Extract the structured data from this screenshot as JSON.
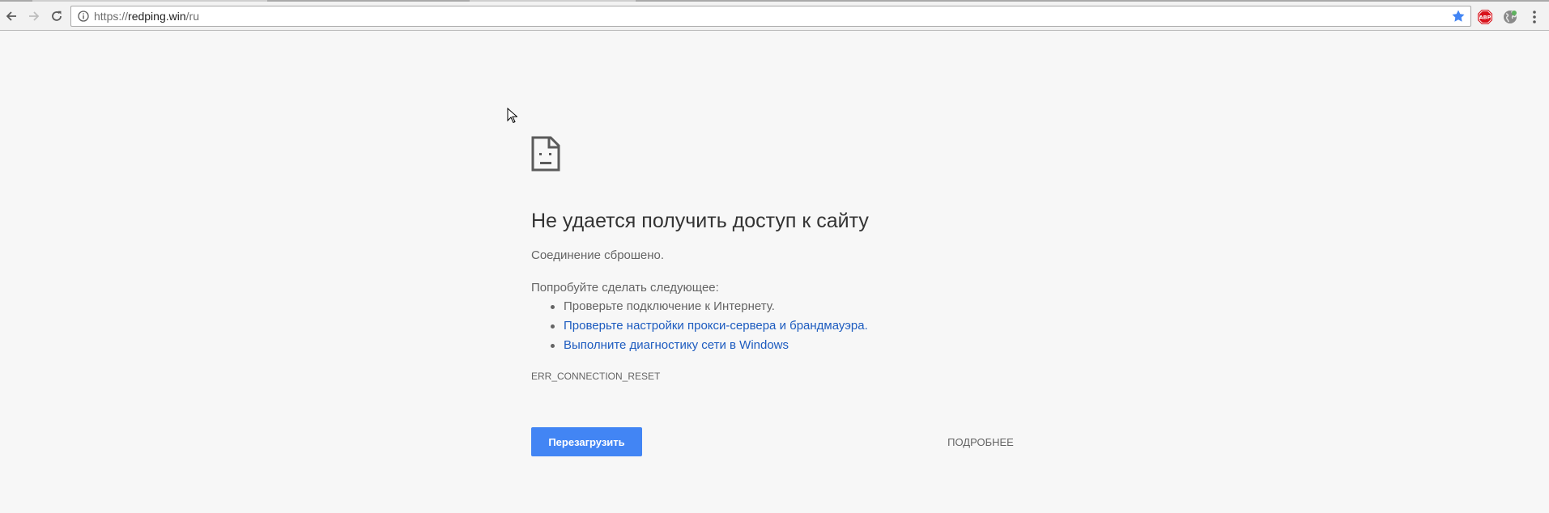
{
  "browser": {
    "url_scheme": "https://",
    "url_host": "redping.win",
    "url_path": "/ru",
    "colors": {
      "star": "#4285f4",
      "abp": "#d8121b"
    }
  },
  "error_page": {
    "heading": "Не удается получить доступ к сайту",
    "message": "Соединение сброшено.",
    "suggestions_intro": "Попробуйте сделать следующее:",
    "suggestions": [
      "Проверьте подключение к Интернету.",
      "Проверьте настройки прокси-сервера и брандмауэра.",
      "Выполните диагностику сети в Windows"
    ],
    "error_code": "ERR_CONNECTION_RESET",
    "reload_label": "Перезагрузить",
    "details_label": "ПОДРОБНЕЕ",
    "colors": {
      "link": "#1c5bbf",
      "primary_button": "#4285f4"
    }
  }
}
